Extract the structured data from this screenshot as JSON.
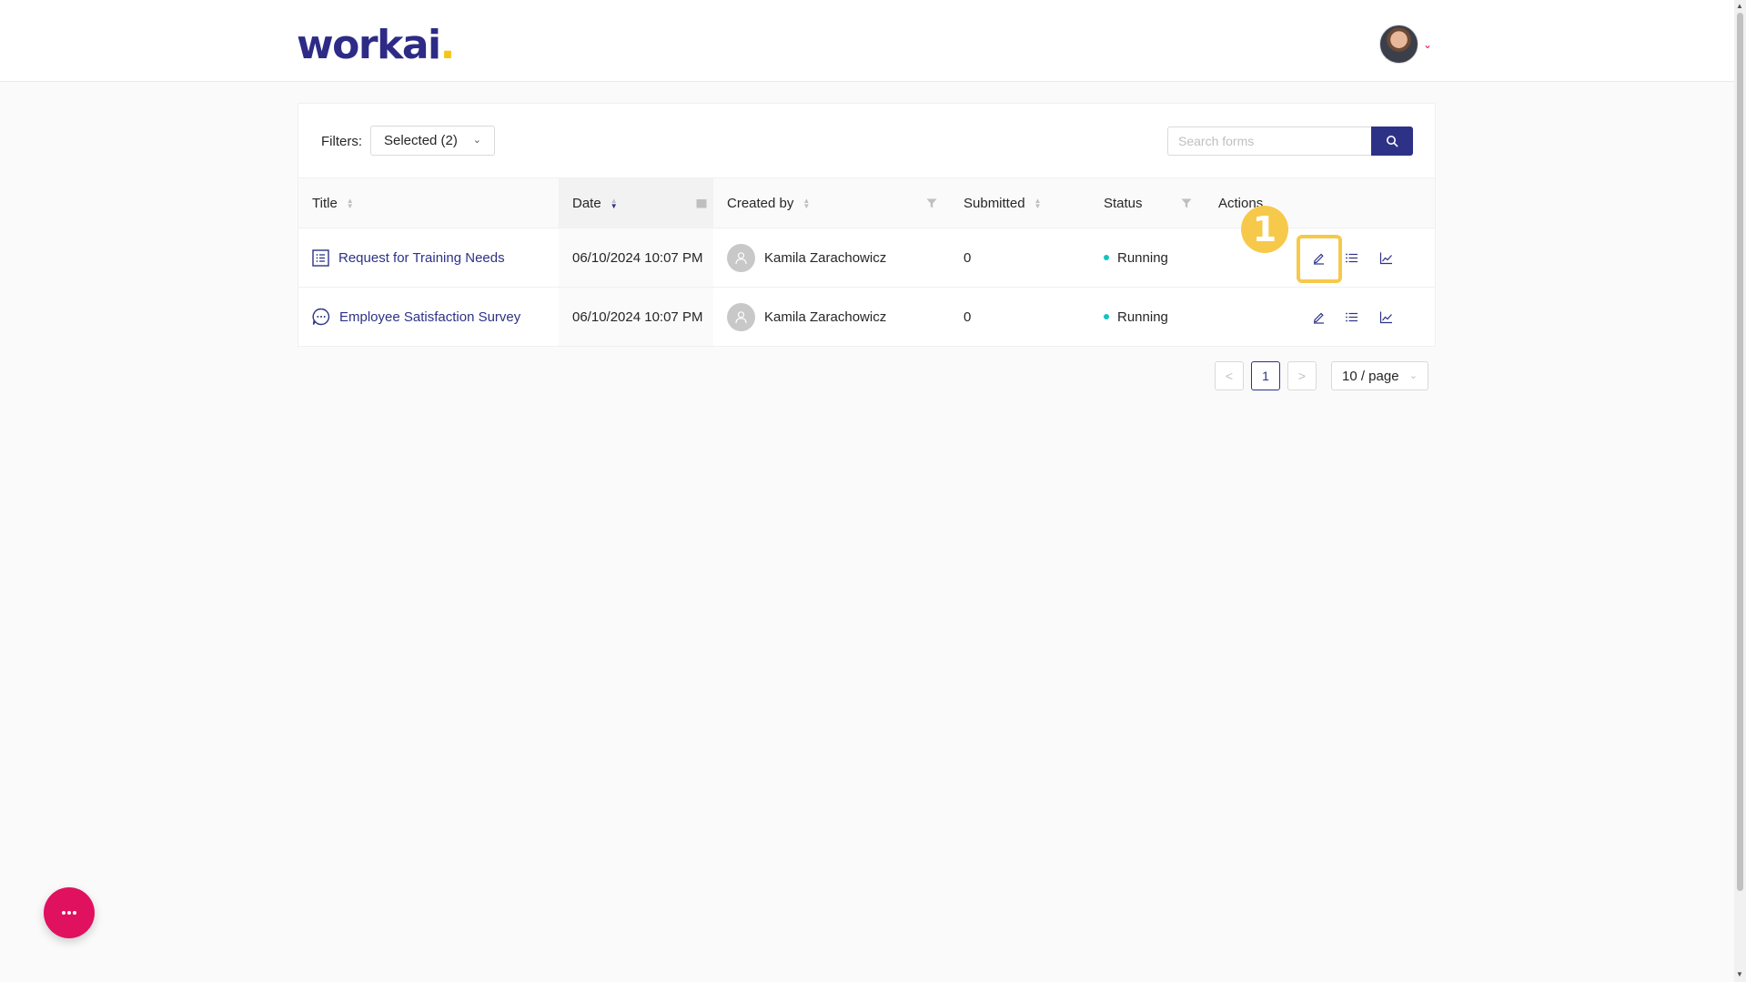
{
  "header": {
    "logo_text": "workai",
    "logo_dot": ".",
    "avatar_caret": "⌄"
  },
  "filters": {
    "label": "Filters:",
    "selected_value": "Selected (2)",
    "search_placeholder": "Search forms"
  },
  "table": {
    "columns": [
      {
        "label": "Title"
      },
      {
        "label": "Date"
      },
      {
        "label": "Created by"
      },
      {
        "label": "Submitted"
      },
      {
        "label": "Status"
      },
      {
        "label": "Actions"
      }
    ],
    "rows": [
      {
        "title": "Request for Training Needs",
        "icon": "list-form-icon",
        "date": "06/10/2024 10:07 PM",
        "created_by": "Kamila Zarachowicz",
        "submitted": "0",
        "status": "Running"
      },
      {
        "title": "Employee Satisfaction Survey",
        "icon": "chat-survey-icon",
        "date": "06/10/2024 10:07 PM",
        "created_by": "Kamila Zarachowicz",
        "submitted": "0",
        "status": "Running"
      }
    ]
  },
  "pagination": {
    "prev": "<",
    "current_page": "1",
    "next": ">",
    "page_size": "10 / page"
  },
  "annotation": {
    "step_number": "1"
  },
  "colors": {
    "brand": "#2d3287",
    "accent": "#e0115f",
    "highlight": "#f7c94a",
    "status_running": "#13c2c2"
  }
}
